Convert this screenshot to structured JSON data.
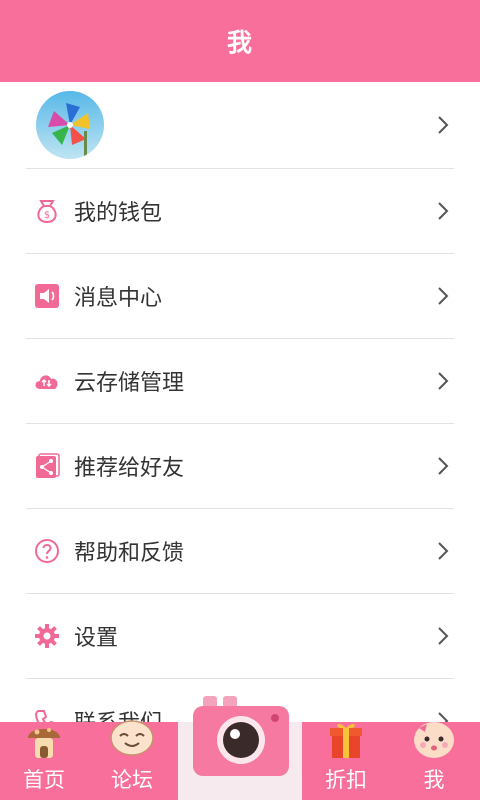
{
  "header": {
    "title": "我"
  },
  "menu": {
    "items": [
      {
        "label": "我的钱包",
        "icon": "wallet-icon"
      },
      {
        "label": "消息中心",
        "icon": "speaker-icon"
      },
      {
        "label": "云存储管理",
        "icon": "cloud-sync-icon"
      },
      {
        "label": "推荐给好友",
        "icon": "share-icon"
      },
      {
        "label": "帮助和反馈",
        "icon": "help-icon"
      },
      {
        "label": "设置",
        "icon": "gear-icon"
      },
      {
        "label": "联系我们",
        "icon": "phone-icon"
      }
    ]
  },
  "tabs": {
    "home": "首页",
    "forum": "论坛",
    "discount": "折扣",
    "me": "我"
  },
  "colors": {
    "accent": "#f76f9a",
    "icon": "#f06a95"
  }
}
